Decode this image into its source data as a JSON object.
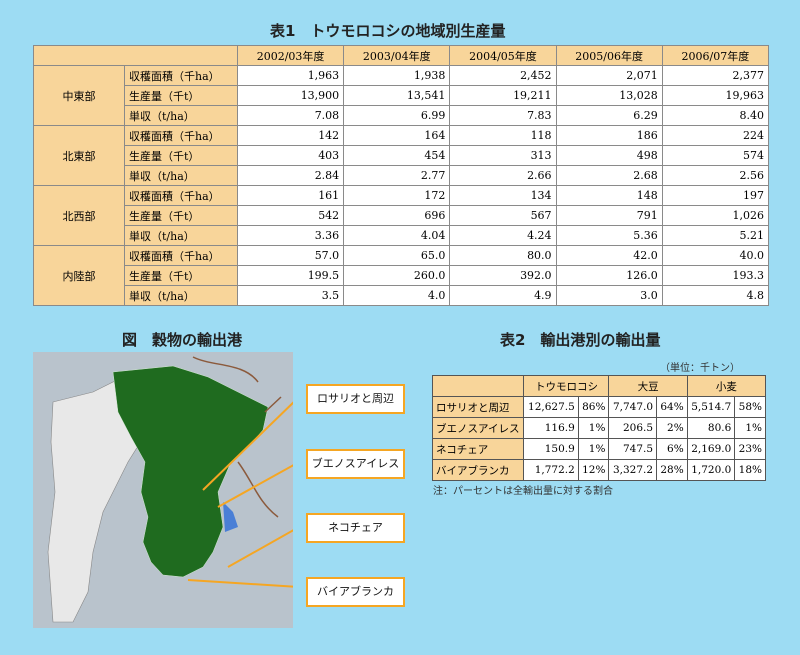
{
  "table1": {
    "title": "表1　トウモロコシの地域別生産量",
    "years": [
      "2002/03年度",
      "2003/04年度",
      "2004/05年度",
      "2005/06年度",
      "2006/07年度"
    ],
    "regions": [
      {
        "name": "中東部",
        "rows": [
          {
            "metric": "収穫面積（千ha）",
            "values": [
              "1,963",
              "1,938",
              "2,452",
              "2,071",
              "2,377"
            ]
          },
          {
            "metric": "生産量（千t）",
            "values": [
              "13,900",
              "13,541",
              "19,211",
              "13,028",
              "19,963"
            ]
          },
          {
            "metric": "単収（t/ha）",
            "values": [
              "7.08",
              "6.99",
              "7.83",
              "6.29",
              "8.40"
            ]
          }
        ]
      },
      {
        "name": "北東部",
        "rows": [
          {
            "metric": "収穫面積（千ha）",
            "values": [
              "142",
              "164",
              "118",
              "186",
              "224"
            ]
          },
          {
            "metric": "生産量（千t）",
            "values": [
              "403",
              "454",
              "313",
              "498",
              "574"
            ]
          },
          {
            "metric": "単収（t/ha）",
            "values": [
              "2.84",
              "2.77",
              "2.66",
              "2.68",
              "2.56"
            ]
          }
        ]
      },
      {
        "name": "北西部",
        "rows": [
          {
            "metric": "収穫面積（千ha）",
            "values": [
              "161",
              "172",
              "134",
              "148",
              "197"
            ]
          },
          {
            "metric": "生産量（千t）",
            "values": [
              "542",
              "696",
              "567",
              "791",
              "1,026"
            ]
          },
          {
            "metric": "単収（t/ha）",
            "values": [
              "3.36",
              "4.04",
              "4.24",
              "5.36",
              "5.21"
            ]
          }
        ]
      },
      {
        "name": "内陸部",
        "rows": [
          {
            "metric": "収穫面積（千ha）",
            "values": [
              "57.0",
              "65.0",
              "80.0",
              "42.0",
              "40.0"
            ]
          },
          {
            "metric": "生産量（千t）",
            "values": [
              "199.5",
              "260.0",
              "392.0",
              "126.0",
              "193.3"
            ]
          },
          {
            "metric": "単収（t/ha）",
            "values": [
              "3.5",
              "4.0",
              "4.9",
              "3.0",
              "4.8"
            ]
          }
        ]
      }
    ]
  },
  "figure": {
    "title": "図　穀物の輸出港",
    "callouts": [
      "ロサリオと周辺",
      "ブエノスアイレス",
      "ネコチェア",
      "バイアブランカ"
    ],
    "colors": {
      "cropland": "#1f6b1f",
      "other": "#e8e8e8",
      "water": "#4a7fd6",
      "border": "#8b5a3c"
    }
  },
  "table2": {
    "title": "表2　輸出港別の輸出量",
    "unit": "（単位：千トン）",
    "columns": [
      "トウモロコシ",
      "大豆",
      "小麦"
    ],
    "rows": [
      {
        "port": "ロサリオと周辺",
        "values": [
          "12,627.5",
          "86%",
          "7,747.0",
          "64%",
          "5,514.7",
          "58%"
        ]
      },
      {
        "port": "ブエノスアイレス",
        "values": [
          "116.9",
          "1%",
          "206.5",
          "2%",
          "80.6",
          "1%"
        ]
      },
      {
        "port": "ネコチェア",
        "values": [
          "150.9",
          "1%",
          "747.5",
          "6%",
          "2,169.0",
          "23%"
        ]
      },
      {
        "port": "バイアブランカ",
        "values": [
          "1,772.2",
          "12%",
          "3,327.2",
          "28%",
          "1,720.0",
          "18%"
        ]
      }
    ],
    "note": "注：パーセントは全輸出量に対する割合"
  }
}
